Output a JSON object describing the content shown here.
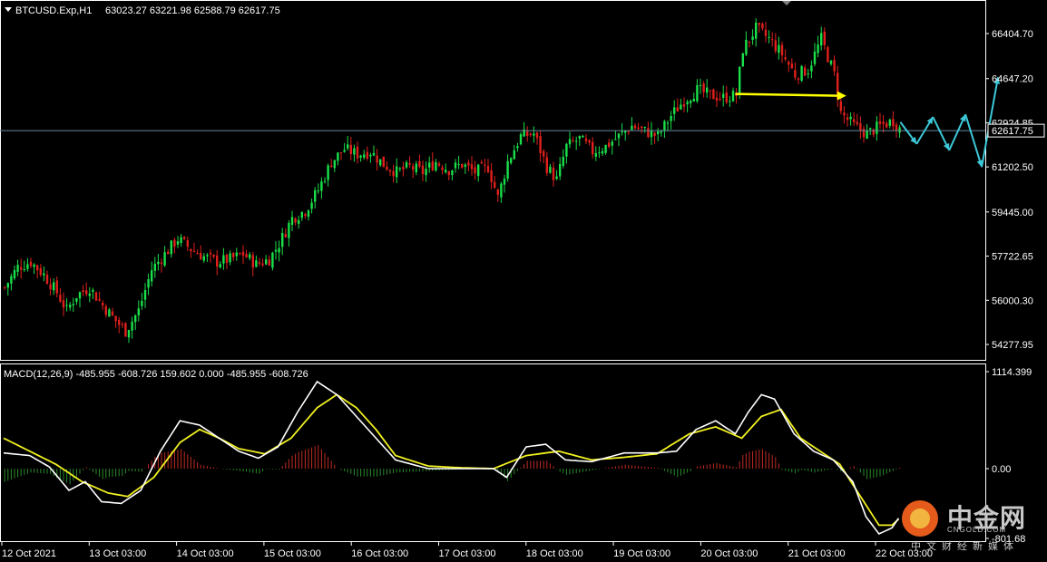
{
  "header": {
    "symbol": "BTCUSD.Exp,H1",
    "ohlc": "63023.27 63221.98 62588.79 62617.75"
  },
  "macd_panel": {
    "label": "MACD(12,26,9) -485.955 -608.726 159.602 0.000 -485.955 -608.726",
    "axis_labels": [
      "1114.399",
      "0.00",
      "-801.68"
    ]
  },
  "price_axis": {
    "labels": [
      "66404.70",
      "64647.20",
      "62924.85",
      "61202.50",
      "59445.00",
      "57722.65",
      "56000.30",
      "54277.95"
    ],
    "current_price": "62617.75"
  },
  "time_axis": {
    "labels": [
      "12 Oct 2021",
      "13 Oct 03:00",
      "14 Oct 03:00",
      "15 Oct 03:00",
      "16 Oct 03:00",
      "17 Oct 03:00",
      "18 Oct 03:00",
      "19 Oct 03:00",
      "20 Oct 03:00",
      "21 Oct 03:00",
      "22 Oct 03:00"
    ]
  },
  "watermark": {
    "cn": "中金网",
    "en": "CNGOLD.COM",
    "sub": "中文财经新媒体"
  },
  "colors": {
    "background": "#000000",
    "bull": "#19e04a",
    "bear": "#e0201c",
    "macd_line": "#ffffff",
    "signal_line": "#f0f020",
    "arrow_yellow": "#ffff00",
    "forecast_cyan": "#3cc8d8",
    "price_line": "#6a8aa0"
  },
  "chart_data": {
    "type": "candlestick",
    "price_axis_ticks": [
      66404.7,
      64647.2,
      62924.85,
      61202.5,
      59445.0,
      57722.65,
      56000.3,
      54277.95
    ],
    "current_price": 62617.75,
    "close_path_anchors": [
      [
        0,
        56500
      ],
      [
        4,
        57300
      ],
      [
        8,
        57500
      ],
      [
        12,
        57000
      ],
      [
        16,
        56300
      ],
      [
        19,
        55600
      ],
      [
        22,
        56200
      ],
      [
        26,
        56500
      ],
      [
        30,
        55800
      ],
      [
        34,
        55200
      ],
      [
        37,
        54800
      ],
      [
        41,
        55600
      ],
      [
        45,
        57200
      ],
      [
        49,
        57800
      ],
      [
        53,
        58400
      ],
      [
        57,
        58000
      ],
      [
        61,
        57700
      ],
      [
        65,
        57500
      ],
      [
        69,
        57600
      ],
      [
        73,
        57800
      ],
      [
        77,
        57400
      ],
      [
        81,
        57600
      ],
      [
        84,
        58200
      ],
      [
        88,
        59200
      ],
      [
        92,
        59500
      ],
      [
        96,
        60300
      ],
      [
        100,
        61400
      ],
      [
        104,
        61900
      ],
      [
        108,
        61700
      ],
      [
        112,
        61800
      ],
      [
        116,
        61300
      ],
      [
        120,
        61000
      ],
      [
        124,
        61200
      ],
      [
        128,
        61000
      ],
      [
        132,
        61400
      ],
      [
        136,
        61100
      ],
      [
        140,
        61300
      ],
      [
        144,
        61000
      ],
      [
        148,
        61200
      ],
      [
        151,
        60000
      ],
      [
        154,
        61400
      ],
      [
        158,
        62400
      ],
      [
        162,
        62500
      ],
      [
        166,
        61200
      ],
      [
        169,
        60700
      ],
      [
        172,
        62000
      ],
      [
        176,
        62300
      ],
      [
        180,
        61800
      ],
      [
        184,
        62000
      ],
      [
        188,
        62400
      ],
      [
        192,
        62800
      ],
      [
        196,
        62600
      ],
      [
        200,
        62400
      ],
      [
        204,
        63200
      ],
      [
        208,
        63800
      ],
      [
        212,
        64200
      ],
      [
        216,
        64000
      ],
      [
        220,
        63900
      ],
      [
        224,
        64000
      ],
      [
        226,
        65800
      ],
      [
        230,
        66600
      ],
      [
        234,
        66200
      ],
      [
        238,
        65600
      ],
      [
        242,
        64800
      ],
      [
        246,
        65000
      ],
      [
        250,
        66200
      ],
      [
        254,
        64800
      ],
      [
        256,
        63300
      ],
      [
        260,
        62800
      ],
      [
        264,
        62500
      ],
      [
        268,
        62800
      ],
      [
        272,
        63000
      ],
      [
        274,
        62700
      ]
    ],
    "yellow_arrow": {
      "from_bar": 224,
      "to_bar": 258,
      "price": 64050
    },
    "forecast_zigzag_prices": [
      62950,
      62100,
      63150,
      61850,
      63250,
      61200,
      64700
    ],
    "macd": {
      "params": "12,26,9",
      "values": {
        "macd": -485.955,
        "signal": -608.726,
        "histogram": 159.602
      },
      "ticks": [
        1114.399,
        0.0,
        -801.68
      ],
      "macd_anchors": [
        [
          0,
          180
        ],
        [
          8,
          150
        ],
        [
          14,
          20
        ],
        [
          20,
          -250
        ],
        [
          25,
          -150
        ],
        [
          30,
          -380
        ],
        [
          36,
          -400
        ],
        [
          42,
          -250
        ],
        [
          48,
          200
        ],
        [
          54,
          550
        ],
        [
          60,
          500
        ],
        [
          66,
          350
        ],
        [
          72,
          200
        ],
        [
          78,
          120
        ],
        [
          84,
          250
        ],
        [
          90,
          650
        ],
        [
          96,
          1000
        ],
        [
          102,
          850
        ],
        [
          108,
          600
        ],
        [
          114,
          350
        ],
        [
          120,
          100
        ],
        [
          130,
          0
        ],
        [
          140,
          0
        ],
        [
          150,
          0
        ],
        [
          154,
          -100
        ],
        [
          160,
          250
        ],
        [
          166,
          280
        ],
        [
          172,
          100
        ],
        [
          180,
          80
        ],
        [
          190,
          180
        ],
        [
          200,
          180
        ],
        [
          206,
          200
        ],
        [
          212,
          450
        ],
        [
          218,
          550
        ],
        [
          224,
          400
        ],
        [
          228,
          650
        ],
        [
          232,
          850
        ],
        [
          236,
          800
        ],
        [
          242,
          400
        ],
        [
          248,
          200
        ],
        [
          254,
          100
        ],
        [
          260,
          -150
        ],
        [
          264,
          -550
        ],
        [
          268,
          -750
        ],
        [
          272,
          -680
        ],
        [
          274,
          -570
        ]
      ],
      "signal_anchors": [
        [
          0,
          350
        ],
        [
          8,
          200
        ],
        [
          16,
          50
        ],
        [
          24,
          -150
        ],
        [
          32,
          -280
        ],
        [
          38,
          -320
        ],
        [
          46,
          -100
        ],
        [
          54,
          300
        ],
        [
          60,
          450
        ],
        [
          66,
          350
        ],
        [
          72,
          230
        ],
        [
          80,
          170
        ],
        [
          88,
          350
        ],
        [
          96,
          700
        ],
        [
          102,
          850
        ],
        [
          108,
          700
        ],
        [
          114,
          450
        ],
        [
          120,
          150
        ],
        [
          130,
          30
        ],
        [
          140,
          10
        ],
        [
          150,
          0
        ],
        [
          160,
          150
        ],
        [
          170,
          200
        ],
        [
          180,
          100
        ],
        [
          190,
          130
        ],
        [
          200,
          170
        ],
        [
          210,
          400
        ],
        [
          218,
          480
        ],
        [
          226,
          350
        ],
        [
          232,
          600
        ],
        [
          238,
          680
        ],
        [
          244,
          350
        ],
        [
          250,
          200
        ],
        [
          256,
          50
        ],
        [
          262,
          -300
        ],
        [
          268,
          -650
        ],
        [
          272,
          -650
        ],
        [
          274,
          -580
        ]
      ]
    }
  }
}
